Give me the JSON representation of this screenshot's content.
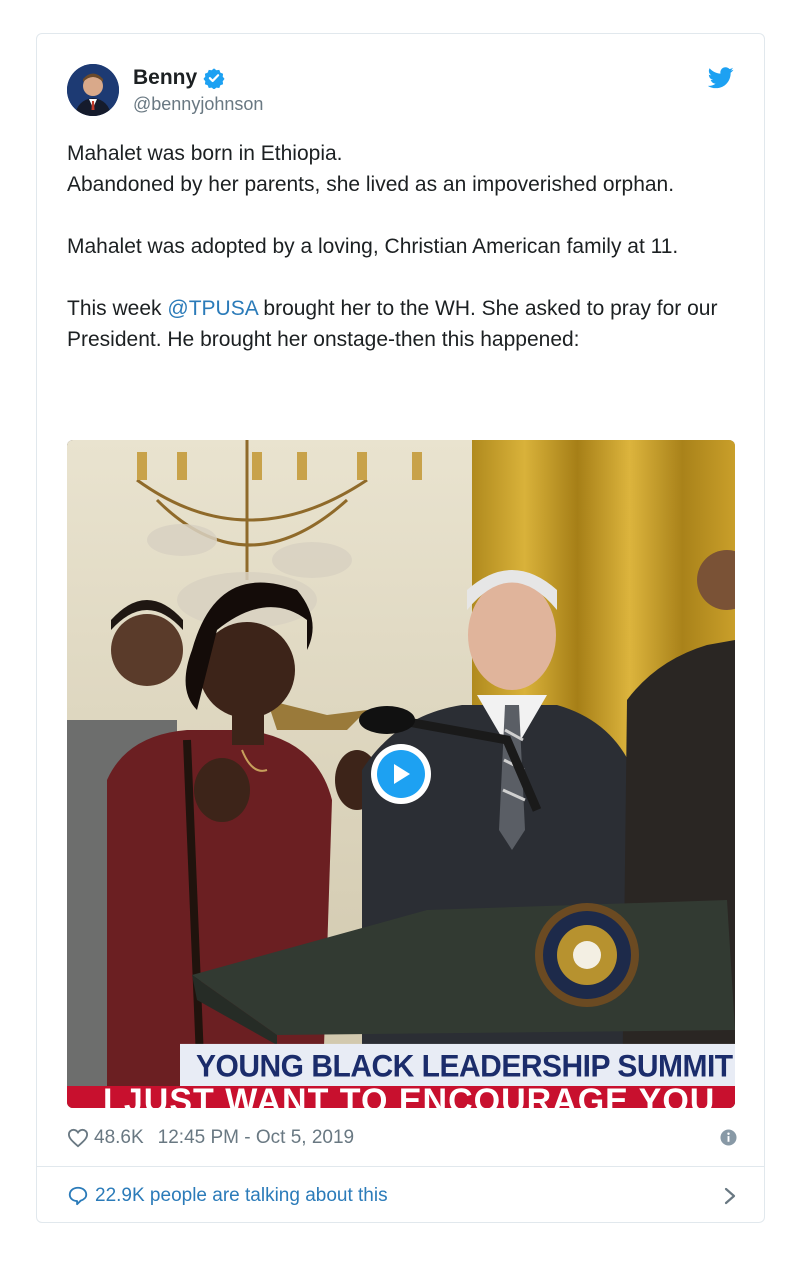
{
  "tweet": {
    "author_name": "Benny",
    "author_handle": "@bennyjohnson",
    "verified": true,
    "text_part1": "Mahalet was born in Ethiopia.\nAbandoned by her parents, she lived as an impoverished orphan.\n\nMahalet was adopted by a loving, Christian American family at 11.\n\nThis week ",
    "mention": "@TPUSA",
    "text_part2": " brought her to the WH. She asked to pray for our President. He brought her onstage-then this happened:",
    "likes": "48.6K",
    "timestamp": "12:45 PM - Oct 5, 2019",
    "talking": "22.9K people are talking about this"
  },
  "video": {
    "lower_third": "YOUNG BLACK LEADERSHIP SUMMIT",
    "ticker": "I JUST WANT TO ENCOURAGE YOU"
  },
  "icons": {
    "verified": "verified-badge-icon",
    "brand": "twitter-bird-icon",
    "play": "play-icon",
    "like": "heart-icon",
    "info": "info-icon",
    "reply": "speech-bubble-icon",
    "more": "chevron-right-icon"
  },
  "colors": {
    "accent": "#1da1f2",
    "link": "#2b7bb9",
    "muted": "#697882",
    "text": "#1c2022",
    "border": "#e1e8ed",
    "ticker_red": "#c8102e",
    "lower_third_blue": "#1b2c6b"
  }
}
